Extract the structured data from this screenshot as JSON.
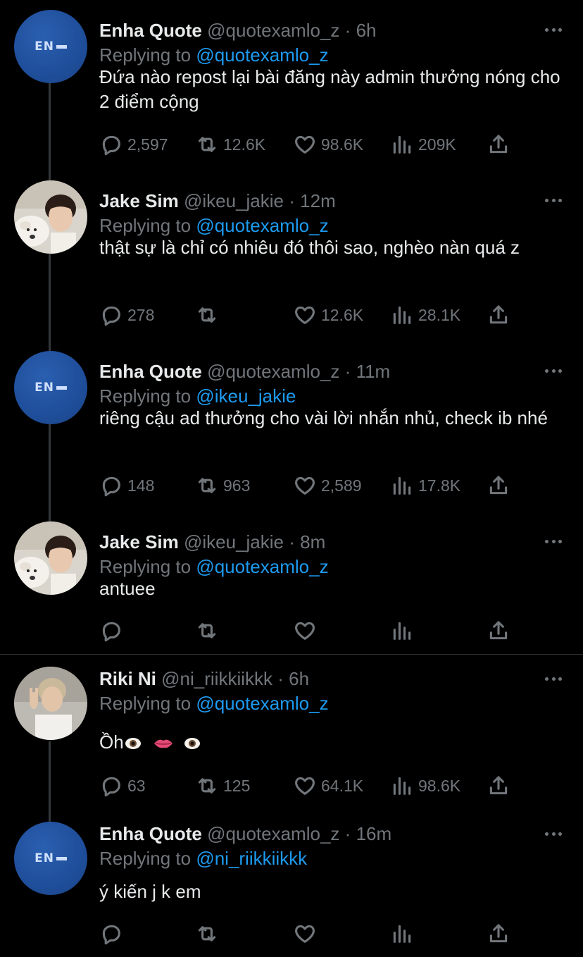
{
  "tweets": [
    {
      "name": "Enha Quote",
      "handle": "@quotexamlo_z",
      "time": "6h",
      "replying_label": "Replying to",
      "replying_to": "@quotexamlo_z",
      "text": "Đứa nào repost lại bài đăng này admin thưởng nóng cho 2 điểm cộng",
      "avatar": "EN-",
      "replies": "2,597",
      "retweets": "12.6K",
      "likes": "98.6K",
      "views": "209K"
    },
    {
      "name": "Jake Sim",
      "handle": "@ikeu_jakie",
      "time": "12m",
      "replying_label": "Replying to",
      "replying_to": "@quotexamlo_z",
      "text": "thật sự là chỉ có nhiêu đó thôi sao, nghèo nàn quá z",
      "replies": "278",
      "retweets": "",
      "likes": "12.6K",
      "views": "28.1K"
    },
    {
      "name": "Enha Quote",
      "handle": "@quotexamlo_z",
      "time": "11m",
      "replying_label": "Replying to",
      "replying_to": "@ikeu_jakie",
      "text": "riêng cậu ad thưởng cho vài lời nhắn nhủ, check ib nhé",
      "avatar": "EN-",
      "replies": "148",
      "retweets": "963",
      "likes": "2,589",
      "views": "17.8K"
    },
    {
      "name": "Jake Sim",
      "handle": "@ikeu_jakie",
      "time": "8m",
      "replying_label": "Replying to",
      "replying_to": "@quotexamlo_z",
      "text": "antuee",
      "replies": "",
      "retweets": "",
      "likes": "",
      "views": ""
    },
    {
      "name": "Riki Ni",
      "handle": "@ni_riikkiikkk",
      "time": "6h",
      "replying_label": "Replying to",
      "replying_to": "@quotexamlo_z",
      "text": "Ồh",
      "replies": "63",
      "retweets": "125",
      "likes": "64.1K",
      "views": "98.6K"
    },
    {
      "name": "Enha Quote",
      "handle": "@quotexamlo_z",
      "time": "16m",
      "replying_label": "Replying to",
      "replying_to": "@ni_riikkiikkk",
      "text": "ý kiến j k em",
      "avatar": "EN-",
      "replies": "",
      "retweets": "",
      "likes": "",
      "views": ""
    }
  ],
  "separator": "·",
  "colors": {
    "background": "#000000",
    "text": "#e7e9ea",
    "muted": "#71767b",
    "link": "#1d9bf0",
    "avatar_blue": "#1f4e9a"
  }
}
